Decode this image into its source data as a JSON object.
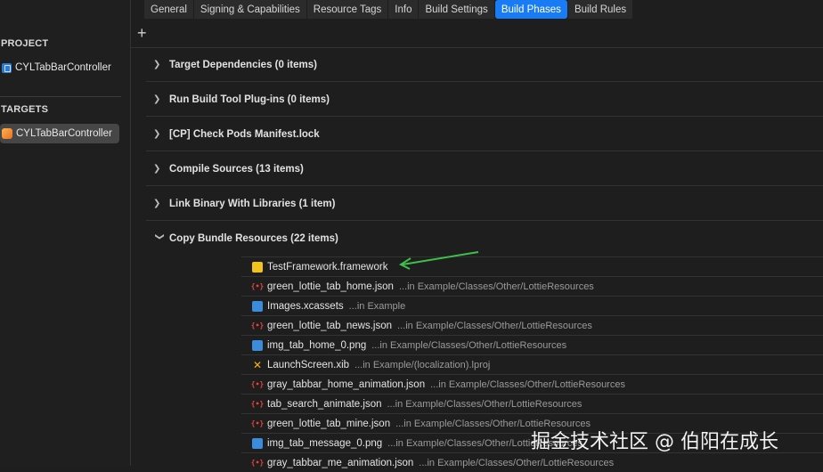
{
  "tabs": [
    "General",
    "Signing & Capabilities",
    "Resource Tags",
    "Info",
    "Build Settings",
    "Build Phases",
    "Build Rules"
  ],
  "active_tab": "Build Phases",
  "add_symbol": "+",
  "sidebar": {
    "project_header": "PROJECT",
    "project_item": "CYLTabBarController",
    "targets_header": "TARGETS",
    "target_item": "CYLTabBarController"
  },
  "phases": [
    "Target Dependencies (0 items)",
    "Run Build Tool Plug-ins (0 items)",
    "[CP] Check Pods Manifest.lock",
    "Compile Sources (13 items)",
    "Link Binary With Libraries (1 item)",
    "Copy Bundle Resources (22 items)"
  ],
  "resources": [
    {
      "name": "TestFramework.framework",
      "location": "",
      "icon": "framework-icon"
    },
    {
      "name": "green_lottie_tab_home.json",
      "location": "...in Example/Classes/Other/LottieResources",
      "icon": "json-icon"
    },
    {
      "name": "Images.xcassets",
      "location": "...in Example",
      "icon": "asset-catalog-icon"
    },
    {
      "name": "green_lottie_tab_news.json",
      "location": "...in Example/Classes/Other/LottieResources",
      "icon": "json-icon"
    },
    {
      "name": "img_tab_home_0.png",
      "location": "...in Example/Classes/Other/LottieResources",
      "icon": "image-icon"
    },
    {
      "name": "LaunchScreen.xib",
      "location": "...in Example/(localization).lproj",
      "icon": "xib-icon"
    },
    {
      "name": "gray_tabbar_home_animation.json",
      "location": "...in Example/Classes/Other/LottieResources",
      "icon": "json-icon"
    },
    {
      "name": "tab_search_animate.json",
      "location": "...in Example/Classes/Other/LottieResources",
      "icon": "json-icon"
    },
    {
      "name": "green_lottie_tab_mine.json",
      "location": "...in Example/Classes/Other/LottieResources",
      "icon": "json-icon"
    },
    {
      "name": "img_tab_message_0.png",
      "location": "...in Example/Classes/Other/LottieResources",
      "icon": "image-icon"
    },
    {
      "name": "gray_tabbar_me_animation.json",
      "location": "...in Example/Classes/Other/LottieResources",
      "icon": "json-icon"
    }
  ],
  "watermark": "掘金技术社区 @ 伯阳在成长",
  "colors": {
    "accent": "#1a7cf5",
    "arrow": "#3fbf4a",
    "background": "#1e1e1e"
  }
}
